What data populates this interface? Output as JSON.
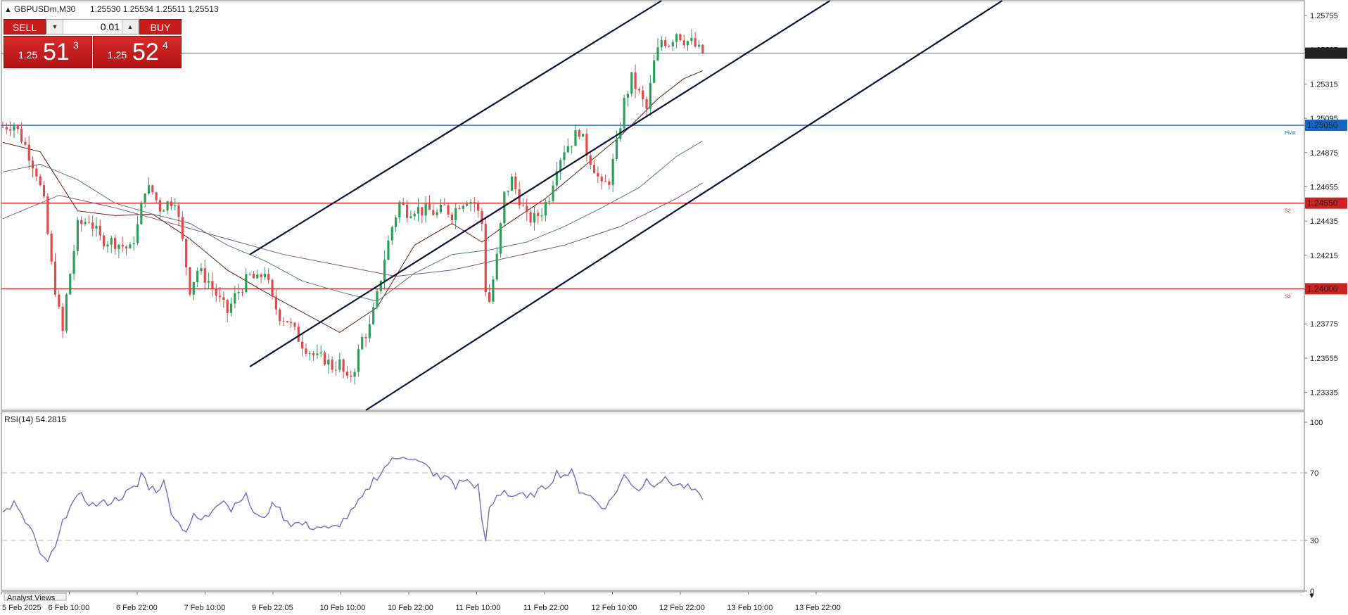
{
  "header": {
    "symbol_label": "GBPUSDm,M30",
    "ohlc": "1.25530 1.25534 1.25511 1.25513"
  },
  "trade_panel": {
    "sell_label": "SELL",
    "buy_label": "BUY",
    "lot_value": "0.01",
    "sell_price": {
      "prefix": "1.25",
      "big": "51",
      "sup": "3"
    },
    "buy_price": {
      "prefix": "1.25",
      "big": "52",
      "sup": "4"
    }
  },
  "price_axis": {
    "ticks": [
      "1.25755",
      "1.25535",
      "1.25315",
      "1.25095",
      "1.24875",
      "1.24655",
      "1.24435",
      "1.24215",
      "1.23995",
      "1.23775",
      "1.23555",
      "1.23335"
    ],
    "range": [
      1.2322,
      1.2585
    ]
  },
  "levels": {
    "current": {
      "value": 1.25513,
      "label": "1.25513",
      "color": "#222222"
    },
    "pivot": {
      "value": 1.2505,
      "label": "1.25050",
      "tag": "Pivot",
      "color": "#1565c0"
    },
    "s2": {
      "value": 1.2455,
      "label": "1.24550",
      "tag": "S2",
      "color": "#cc2222"
    },
    "s3": {
      "value": 1.24,
      "label": "1.24000",
      "tag": "S3",
      "color": "#cc2222"
    }
  },
  "rsi": {
    "label": "RSI(14) 54.2815",
    "ticks": [
      "100",
      "70",
      "30",
      "0"
    ],
    "levels": [
      70,
      30
    ],
    "color": "#7b68c8"
  },
  "time_axis": {
    "labels": [
      "5 Feb 2025",
      "6 Feb 10:00",
      "6 Feb 22:00",
      "7 Feb 10:00",
      "9 Feb 22:05",
      "10 Feb 10:00",
      "10 Feb 22:00",
      "11 Feb 10:00",
      "11 Feb 22:00",
      "12 Feb 10:00",
      "12 Feb 22:00",
      "13 Feb 10:00",
      "13 Feb 22:00"
    ]
  },
  "bottom_tab": "Analyst Views",
  "colors": {
    "bull": "#2e9e5a",
    "bear": "#e04a4a",
    "channel": "#0a1240"
  },
  "chart_data": {
    "type": "candlestick",
    "title": "GBPUSDm,M30",
    "price_path": [
      [
        0,
        1.2504
      ],
      [
        3,
        1.2506
      ],
      [
        6,
        1.2492
      ],
      [
        9,
        1.2475
      ],
      [
        11,
        1.2455
      ],
      [
        13,
        1.2415
      ],
      [
        15,
        1.2385
      ],
      [
        16,
        1.2372
      ],
      [
        17,
        1.2395
      ],
      [
        20,
        1.244
      ],
      [
        23,
        1.2445
      ],
      [
        26,
        1.2432
      ],
      [
        30,
        1.243
      ],
      [
        34,
        1.2425
      ],
      [
        36,
        1.244
      ],
      [
        38,
        1.2465
      ],
      [
        40,
        1.2462
      ],
      [
        42,
        1.2452
      ],
      [
        44,
        1.2455
      ],
      [
        46,
        1.2458
      ],
      [
        48,
        1.243
      ],
      [
        50,
        1.24
      ],
      [
        52,
        1.2412
      ],
      [
        55,
        1.2405
      ],
      [
        58,
        1.2392
      ],
      [
        60,
        1.2385
      ],
      [
        62,
        1.2395
      ],
      [
        64,
        1.2402
      ],
      [
        66,
        1.2408
      ],
      [
        68,
        1.2405
      ],
      [
        70,
        1.2412
      ],
      [
        72,
        1.2392
      ],
      [
        74,
        1.2383
      ],
      [
        76,
        1.238
      ],
      [
        78,
        1.2372
      ],
      [
        80,
        1.2365
      ],
      [
        82,
        1.236
      ],
      [
        84,
        1.2355
      ],
      [
        86,
        1.2355
      ],
      [
        88,
        1.235
      ],
      [
        90,
        1.2352
      ],
      [
        92,
        1.234
      ],
      [
        94,
        1.235
      ],
      [
        96,
        1.2368
      ],
      [
        98,
        1.2375
      ],
      [
        100,
        1.2395
      ],
      [
        102,
        1.242
      ],
      [
        104,
        1.244
      ],
      [
        106,
        1.2455
      ],
      [
        108,
        1.245
      ],
      [
        110,
        1.2452
      ],
      [
        112,
        1.245
      ],
      [
        114,
        1.245
      ],
      [
        116,
        1.2448
      ],
      [
        118,
        1.2452
      ],
      [
        120,
        1.2448
      ],
      [
        122,
        1.2455
      ],
      [
        124,
        1.2458
      ],
      [
        126,
        1.2455
      ],
      [
        128,
        1.2442
      ],
      [
        129,
        1.24
      ],
      [
        130,
        1.2392
      ],
      [
        132,
        1.242
      ],
      [
        134,
        1.246
      ],
      [
        136,
        1.247
      ],
      [
        138,
        1.2458
      ],
      [
        140,
        1.2445
      ],
      [
        142,
        1.2445
      ],
      [
        144,
        1.245
      ],
      [
        146,
        1.246
      ],
      [
        148,
        1.248
      ],
      [
        150,
        1.249
      ],
      [
        152,
        1.2495
      ],
      [
        154,
        1.2502
      ],
      [
        156,
        1.2488
      ],
      [
        158,
        1.2478
      ],
      [
        160,
        1.2465
      ],
      [
        162,
        1.247
      ],
      [
        164,
        1.2492
      ],
      [
        166,
        1.252
      ],
      [
        168,
        1.2535
      ],
      [
        170,
        1.2525
      ],
      [
        172,
        1.2515
      ],
      [
        174,
        1.2545
      ],
      [
        176,
        1.256
      ],
      [
        178,
        1.2558
      ],
      [
        180,
        1.2565
      ],
      [
        182,
        1.256
      ],
      [
        184,
        1.2558
      ],
      [
        186,
        1.2553
      ],
      [
        187,
        1.25513
      ]
    ],
    "rsi_path": [
      [
        0,
        46
      ],
      [
        3,
        52
      ],
      [
        5,
        44
      ],
      [
        8,
        35
      ],
      [
        10,
        20
      ],
      [
        12,
        18
      ],
      [
        14,
        25
      ],
      [
        16,
        40
      ],
      [
        18,
        52
      ],
      [
        21,
        56
      ],
      [
        24,
        51
      ],
      [
        27,
        52
      ],
      [
        30,
        54
      ],
      [
        33,
        58
      ],
      [
        36,
        62
      ],
      [
        37,
        70
      ],
      [
        39,
        62
      ],
      [
        41,
        60
      ],
      [
        43,
        64
      ],
      [
        45,
        48
      ],
      [
        47,
        40
      ],
      [
        49,
        36
      ],
      [
        51,
        44
      ],
      [
        53,
        42
      ],
      [
        55,
        45
      ],
      [
        57,
        52
      ],
      [
        59,
        55
      ],
      [
        61,
        48
      ],
      [
        63,
        55
      ],
      [
        65,
        56
      ],
      [
        67,
        47
      ],
      [
        69,
        42
      ],
      [
        71,
        48
      ],
      [
        73,
        52
      ],
      [
        75,
        44
      ],
      [
        77,
        40
      ],
      [
        79,
        40
      ],
      [
        81,
        39
      ],
      [
        83,
        38
      ],
      [
        85,
        38
      ],
      [
        87,
        36
      ],
      [
        89,
        38
      ],
      [
        91,
        42
      ],
      [
        93,
        46
      ],
      [
        95,
        52
      ],
      [
        97,
        58
      ],
      [
        99,
        66
      ],
      [
        101,
        70
      ],
      [
        103,
        76
      ],
      [
        105,
        78
      ],
      [
        107,
        81
      ],
      [
        109,
        79
      ],
      [
        111,
        76
      ],
      [
        113,
        74
      ],
      [
        115,
        70
      ],
      [
        117,
        66
      ],
      [
        119,
        68
      ],
      [
        121,
        62
      ],
      [
        123,
        66
      ],
      [
        125,
        64
      ],
      [
        127,
        62
      ],
      [
        128,
        40
      ],
      [
        129,
        30
      ],
      [
        130,
        48
      ],
      [
        132,
        56
      ],
      [
        134,
        60
      ],
      [
        136,
        56
      ],
      [
        138,
        58
      ],
      [
        140,
        54
      ],
      [
        142,
        58
      ],
      [
        144,
        60
      ],
      [
        146,
        64
      ],
      [
        148,
        70
      ],
      [
        150,
        69
      ],
      [
        152,
        70
      ],
      [
        154,
        60
      ],
      [
        156,
        58
      ],
      [
        158,
        54
      ],
      [
        160,
        50
      ],
      [
        162,
        52
      ],
      [
        164,
        60
      ],
      [
        166,
        68
      ],
      [
        168,
        64
      ],
      [
        170,
        60
      ],
      [
        172,
        66
      ],
      [
        174,
        64
      ],
      [
        176,
        66
      ],
      [
        178,
        65
      ],
      [
        180,
        63
      ],
      [
        182,
        62
      ],
      [
        184,
        60
      ],
      [
        186,
        56
      ],
      [
        187,
        54.28
      ]
    ],
    "moving_averages": [
      {
        "color": "#6b1a1a",
        "points": [
          [
            0,
            1.2494
          ],
          [
            10,
            1.2488
          ],
          [
            20,
            1.245
          ],
          [
            30,
            1.2447
          ],
          [
            40,
            1.2448
          ],
          [
            50,
            1.2432
          ],
          [
            60,
            1.2412
          ],
          [
            70,
            1.2398
          ],
          [
            80,
            1.2385
          ],
          [
            90,
            1.2372
          ],
          [
            100,
            1.2388
          ],
          [
            110,
            1.2428
          ],
          [
            120,
            1.2442
          ],
          [
            128,
            1.243
          ],
          [
            135,
            1.2442
          ],
          [
            145,
            1.2458
          ],
          [
            155,
            1.2478
          ],
          [
            165,
            1.2498
          ],
          [
            175,
            1.2522
          ],
          [
            182,
            1.2535
          ],
          [
            187,
            1.254
          ]
        ]
      },
      {
        "color": "#5a7a78",
        "points": [
          [
            0,
            1.2475
          ],
          [
            10,
            1.248
          ],
          [
            20,
            1.247
          ],
          [
            30,
            1.2455
          ],
          [
            40,
            1.2448
          ],
          [
            50,
            1.2442
          ],
          [
            60,
            1.2428
          ],
          [
            70,
            1.2418
          ],
          [
            80,
            1.2405
          ],
          [
            90,
            1.2398
          ],
          [
            100,
            1.2392
          ],
          [
            110,
            1.241
          ],
          [
            120,
            1.2422
          ],
          [
            130,
            1.2425
          ],
          [
            140,
            1.243
          ],
          [
            150,
            1.244
          ],
          [
            160,
            1.2452
          ],
          [
            170,
            1.2465
          ],
          [
            180,
            1.2485
          ],
          [
            187,
            1.2495
          ]
        ]
      },
      {
        "color": "#7a5a8a",
        "points": [
          [
            0,
            1.2445
          ],
          [
            15,
            1.246
          ],
          [
            30,
            1.2452
          ],
          [
            45,
            1.2442
          ],
          [
            60,
            1.2432
          ],
          [
            75,
            1.2422
          ],
          [
            90,
            1.2415
          ],
          [
            105,
            1.2408
          ],
          [
            120,
            1.2412
          ],
          [
            135,
            1.242
          ],
          [
            150,
            1.2428
          ],
          [
            165,
            1.244
          ],
          [
            180,
            1.2458
          ],
          [
            187,
            1.2468
          ]
        ]
      }
    ],
    "channel_lines": [
      {
        "from": [
          66,
          1.2422
        ],
        "to": [
          176,
          1.2585
        ]
      },
      {
        "from": [
          66,
          1.235
        ],
        "to": [
          221,
          1.2585
        ]
      },
      {
        "from": [
          97,
          1.2322
        ],
        "to": [
          267,
          1.2585
        ]
      }
    ]
  }
}
